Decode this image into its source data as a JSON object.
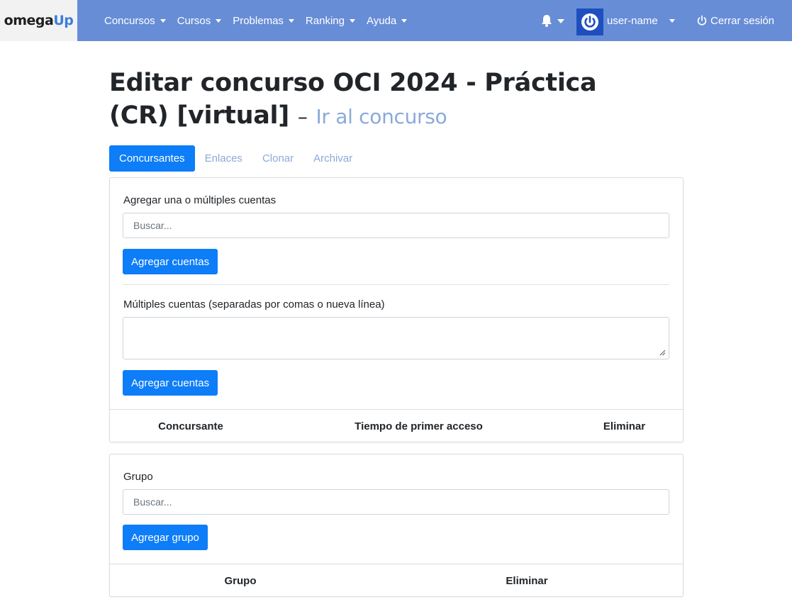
{
  "brand": {
    "part1": "omega",
    "part2": "Up"
  },
  "nav": {
    "items": [
      {
        "label": "Concursos"
      },
      {
        "label": "Cursos"
      },
      {
        "label": "Problemas"
      },
      {
        "label": "Ranking"
      },
      {
        "label": "Ayuda"
      }
    ],
    "user_name": "user-name",
    "logout_label": "Cerrar sesión"
  },
  "page": {
    "title": "Editar concurso OCI 2024 - Práctica (CR) [virtual]",
    "title_separator": "–",
    "title_link": "Ir al concurso"
  },
  "tabs": [
    {
      "label": "Concursantes",
      "active": true
    },
    {
      "label": "Enlaces",
      "active": false
    },
    {
      "label": "Clonar",
      "active": false
    },
    {
      "label": "Archivar",
      "active": false
    }
  ],
  "contestants_card": {
    "add_label": "Agregar una o múltiples cuentas",
    "search_placeholder": "Buscar...",
    "add_button": "Agregar cuentas",
    "multiple_label": "Múltiples cuentas (separadas por comas o nueva línea)",
    "multiple_button": "Agregar cuentas",
    "columns": [
      "Concursante",
      "Tiempo de primer acceso",
      "Eliminar"
    ]
  },
  "group_card": {
    "label": "Grupo",
    "search_placeholder": "Buscar...",
    "add_button": "Agregar grupo",
    "columns": [
      "Grupo",
      "Eliminar"
    ]
  },
  "colors": {
    "navbar": "#678dd7",
    "primary": "#0d7df8",
    "link": "#8aaad9",
    "avatar": "#1f4fbf"
  }
}
